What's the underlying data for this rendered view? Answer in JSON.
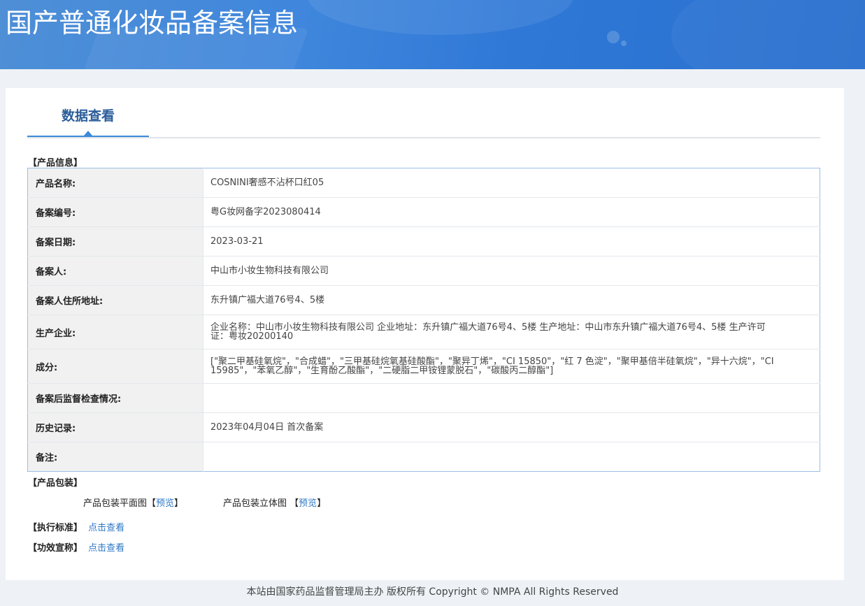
{
  "banner": {
    "title": "国产普通化妆品备案信息"
  },
  "tab": {
    "label": "数据查看"
  },
  "product_info": {
    "section_title": "【产品信息】",
    "rows": [
      {
        "label": "产品名称:",
        "value": "COSNINI奢感不沾杯口红05"
      },
      {
        "label": "备案编号:",
        "value": "粤G妆网备字2023080414"
      },
      {
        "label": "备案日期:",
        "value": "2023-03-21"
      },
      {
        "label": "备案人:",
        "value": "中山市小妆生物科技有限公司"
      },
      {
        "label": "备案人住所地址:",
        "value": "东升镇广福大道76号4、5楼"
      },
      {
        "label": "生产企业:",
        "value": "企业名称：中山市小妆生物科技有限公司 企业地址：东升镇广福大道76号4、5楼 生产地址：中山市东升镇广福大道76号4、5楼 生产许可证：粤妆20200140"
      },
      {
        "label": "成分:",
        "value": "[\"聚二甲基硅氧烷\"，\"合成蜡\"，\"三甲基硅烷氧基硅酸酯\"，\"聚异丁烯\"，\"CI 15850\"，\"红 7 色淀\"，\"聚甲基倍半硅氧烷\"，\"异十六烷\"，\"CI 15985\"，\"苯氧乙醇\"，\"生育酚乙酸酯\"，\"二硬脂二甲铵锂蒙脱石\"，\"碳酸丙二醇酯\"]"
      },
      {
        "label": "备案后监督检查情况:",
        "value": ""
      },
      {
        "label": "历史记录:",
        "value": "2023年04月04日 首次备案"
      },
      {
        "label": "备注:",
        "value": ""
      }
    ]
  },
  "packaging": {
    "section_title": "【产品包装】",
    "flat_label": "产品包装平面图",
    "flat_link": "预览",
    "solid_label": "产品包装立体图",
    "solid_link": "预览",
    "bracket_open": "【",
    "bracket_close": "】"
  },
  "standard": {
    "section_title": "【执行标准】",
    "link": "点击查看"
  },
  "efficacy": {
    "section_title": "【功效宣称】",
    "link": "点击查看"
  },
  "footer": {
    "text": "本站由国家药品监督管理局主办 版权所有 Copyright © NMPA All Rights Reserved"
  }
}
